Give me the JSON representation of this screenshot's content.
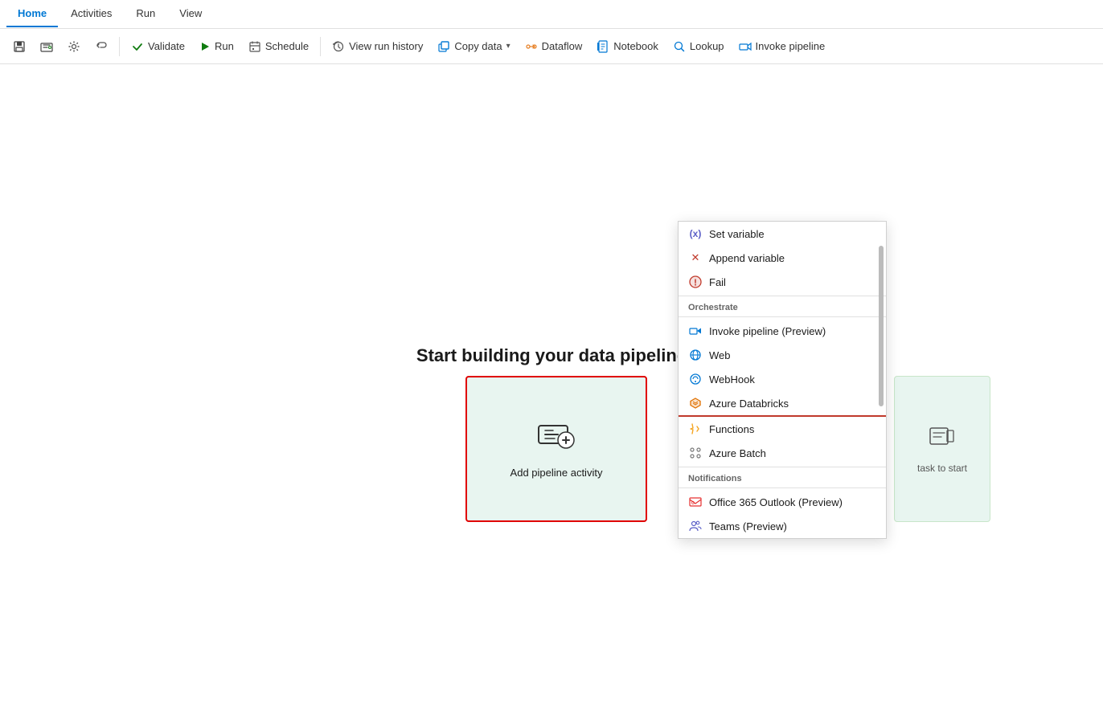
{
  "navTabs": [
    {
      "label": "Home",
      "active": true
    },
    {
      "label": "Activities",
      "active": false
    },
    {
      "label": "Run",
      "active": false
    },
    {
      "label": "View",
      "active": false
    }
  ],
  "toolbar": {
    "save_label": "",
    "validate_label": "Validate",
    "run_label": "Run",
    "schedule_label": "Schedule",
    "viewrunhistory_label": "View run history",
    "copydata_label": "Copy data",
    "dataflow_label": "Dataflow",
    "notebook_label": "Notebook",
    "lookup_label": "Lookup",
    "invokepipeline_label": "Invoke pipeline"
  },
  "canvas": {
    "heading": "Start building your data pipeline",
    "add_activity_label": "Add pipeline activity",
    "right_card_label": "task to start"
  },
  "dropdownMenu": {
    "items": [
      {
        "type": "item",
        "label": "Set variable",
        "icon": "(x)",
        "iconColor": "#5b5fc7",
        "group": null
      },
      {
        "type": "item",
        "label": "Append variable",
        "icon": "✕",
        "iconColor": "#e03030",
        "group": null
      },
      {
        "type": "item",
        "label": "Fail",
        "icon": "!",
        "iconColor": "#e03030",
        "group": null
      },
      {
        "type": "section",
        "label": "Orchestrate"
      },
      {
        "type": "item",
        "label": "Invoke pipeline (Preview)",
        "icon": "pipe",
        "iconColor": "#0078d4"
      },
      {
        "type": "item",
        "label": "Web",
        "icon": "🌐",
        "iconColor": "#0078d4"
      },
      {
        "type": "item",
        "label": "WebHook",
        "icon": "hook",
        "iconColor": "#0078d4"
      },
      {
        "type": "item",
        "label": "Azure Databricks",
        "icon": "db",
        "iconColor": "#e07000",
        "underlined": true
      },
      {
        "type": "item",
        "label": "Functions",
        "icon": "fn",
        "iconColor": "#f5a623"
      },
      {
        "type": "item",
        "label": "Azure Batch",
        "icon": "batch",
        "iconColor": "#777"
      },
      {
        "type": "section",
        "label": "Notifications"
      },
      {
        "type": "item",
        "label": "Office 365 Outlook (Preview)",
        "icon": "O365",
        "iconColor": "#e63030"
      },
      {
        "type": "item",
        "label": "Teams (Preview)",
        "icon": "T",
        "iconColor": "#5b5fc7"
      }
    ]
  }
}
